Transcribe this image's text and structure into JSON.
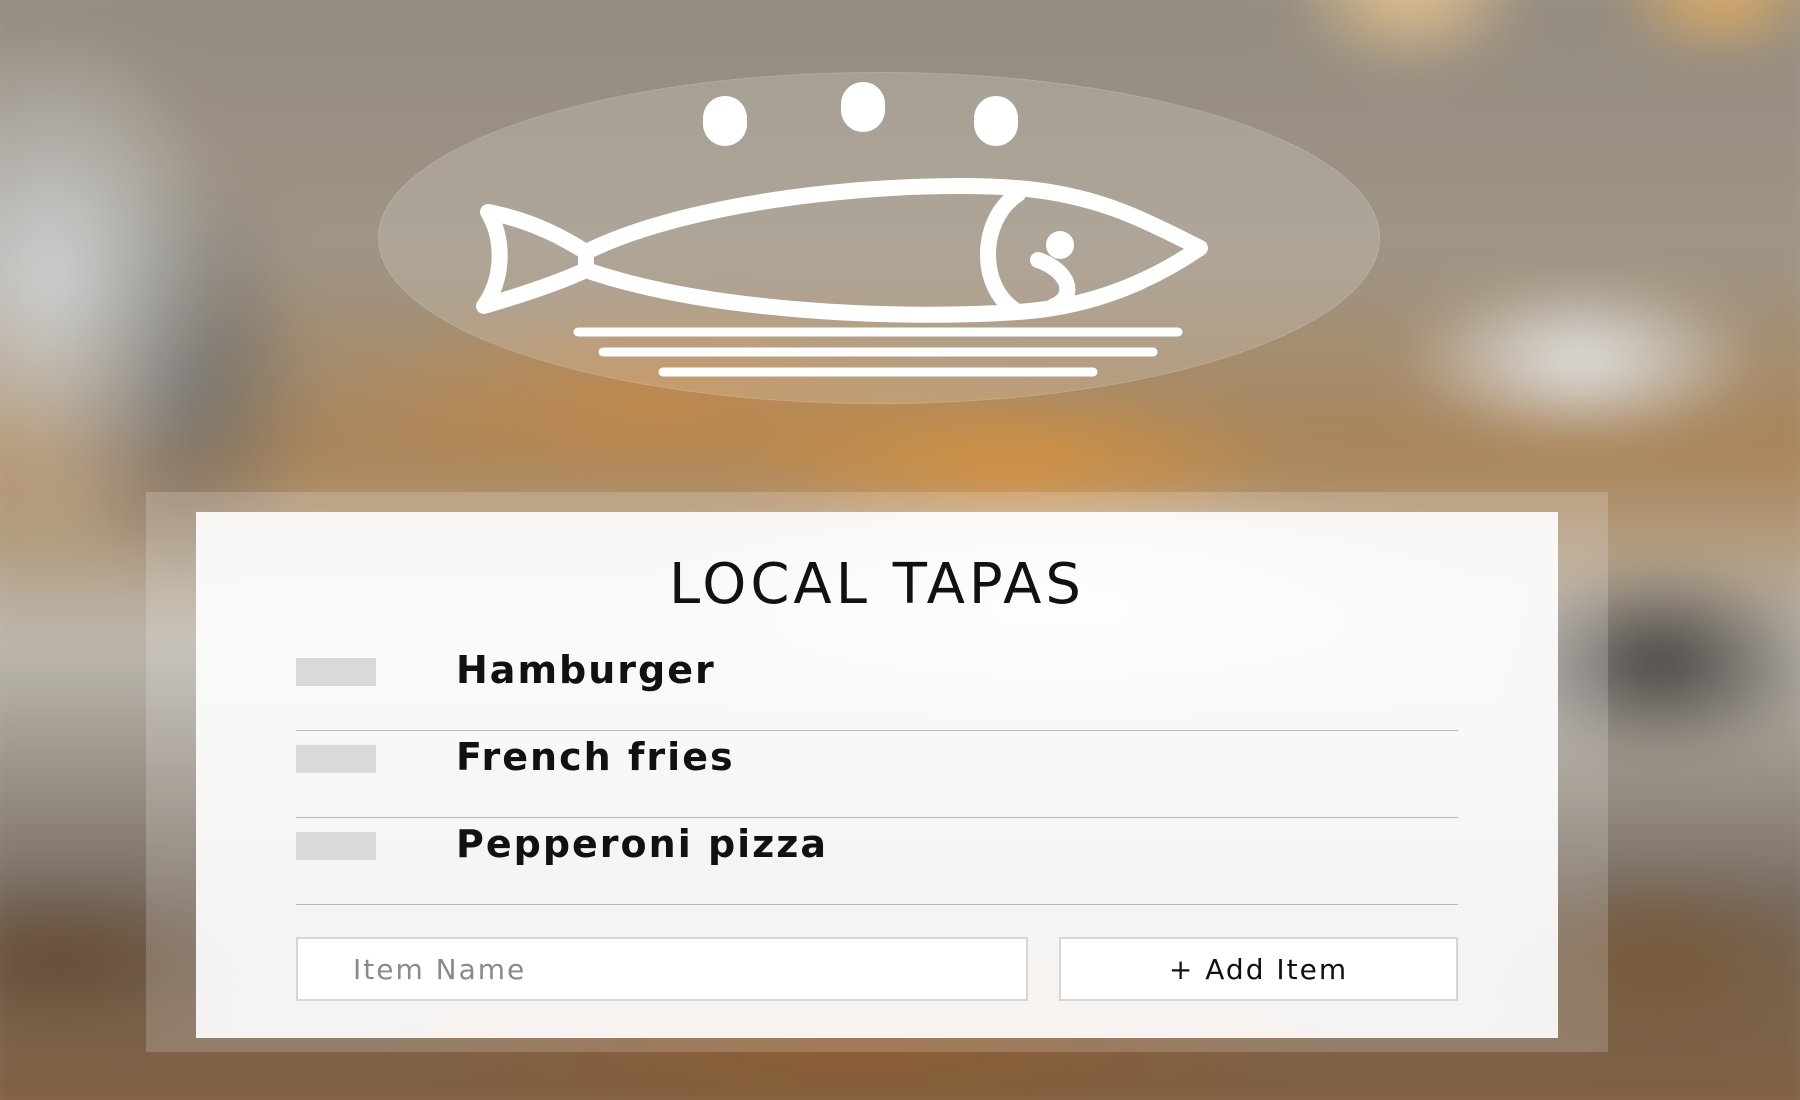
{
  "app": {
    "title": "LOCAL TAPAS",
    "logo_icon": "fish-dish-icon"
  },
  "menu": {
    "items": [
      {
        "label": "Hamburger",
        "checked": false
      },
      {
        "label": "French fries",
        "checked": false
      },
      {
        "label": "Pepperoni pizza",
        "checked": false
      }
    ]
  },
  "add_form": {
    "placeholder": "Item Name",
    "value": "",
    "button_label": "+ Add Item"
  },
  "colors": {
    "card_background": "#ffffff",
    "text": "#111111",
    "checkbox": "#d9d9d9",
    "divider": "#b8b8b8"
  }
}
